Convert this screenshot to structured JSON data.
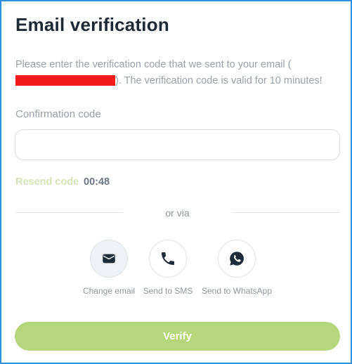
{
  "dialog": {
    "title": "Email verification",
    "description_before": "Please enter the verification code that we sent to your email (",
    "description_after": "). The verification code is valid for 10 minutes!",
    "code_label": "Confirmation code",
    "code_value": "",
    "resend_label": "Resend code",
    "timer": "00:48",
    "divider_text": "or via",
    "methods": [
      {
        "icon": "envelope-icon",
        "label": "Change email",
        "active": true
      },
      {
        "icon": "phone-icon",
        "label": "Send to SMS",
        "active": false
      },
      {
        "icon": "whatsapp-icon",
        "label": "Send to WhatsApp",
        "active": false
      }
    ],
    "verify_label": "Verify"
  },
  "colors": {
    "frame_border": "#2f8fe0",
    "title": "#1f2933",
    "muted_text": "#9aa1a9",
    "redaction": "#f41b1b",
    "resend_disabled": "#d5e4b7",
    "timer": "#6b7580",
    "verify_button": "#b6d67c",
    "icon": "#1f2a3a"
  }
}
